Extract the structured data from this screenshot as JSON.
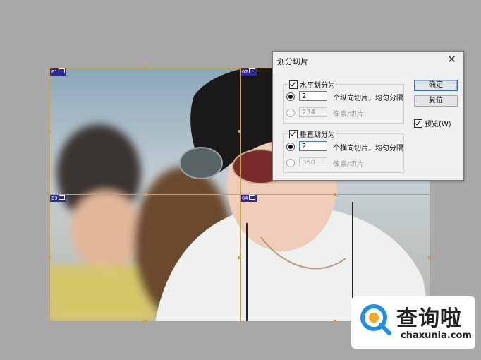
{
  "dialog": {
    "title": "划分切片",
    "horizontal": {
      "legend": "水平划分为",
      "option1_value": "2",
      "option1_label": "个纵向切片，均匀分隔",
      "option2_value": "234",
      "option2_label": "像素/切片"
    },
    "vertical": {
      "legend": "垂直划分为",
      "option1_value": "2",
      "option1_label": "个横向切片，均匀分隔",
      "option2_value": "350",
      "option2_label": "像素/切片"
    },
    "ok_label": "确定",
    "reset_label": "复位",
    "preview_label": "预览(W)"
  },
  "slices": {
    "tags": [
      "01",
      "02",
      "03",
      "04"
    ]
  },
  "watermark": {
    "text": "查询啦",
    "url": "chaxunla.com"
  },
  "colors": {
    "background": "#a9a9a9",
    "guide": "#c9a24a",
    "slice_tag": "#2d2a9f",
    "accent": "#2b6fd1"
  }
}
